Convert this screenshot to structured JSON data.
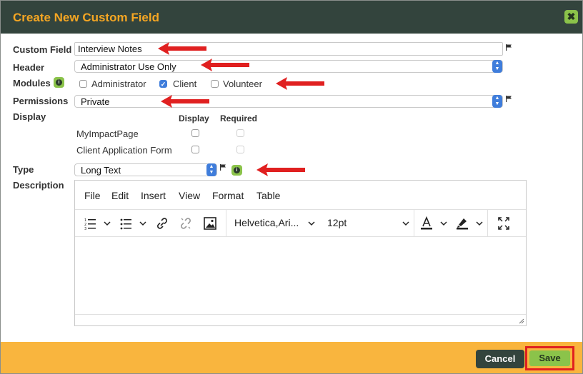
{
  "dialog": {
    "title": "Create New Custom Field",
    "close_icon": "close-icon"
  },
  "form": {
    "custom_field": {
      "label": "Custom Field",
      "value": "Interview Notes"
    },
    "header": {
      "label": "Header",
      "value": "Administrator Use Only"
    },
    "modules": {
      "label": "Modules",
      "options": [
        {
          "label": "Administrator",
          "checked": false
        },
        {
          "label": "Client",
          "checked": true
        },
        {
          "label": "Volunteer",
          "checked": false
        }
      ]
    },
    "permissions": {
      "label": "Permissions",
      "value": "Private"
    },
    "display": {
      "label": "Display",
      "col_display": "Display",
      "col_required": "Required",
      "rows": [
        {
          "label": "MyImpactPage",
          "display": false,
          "required": false
        },
        {
          "label": "Client Application Form",
          "display": false,
          "required": false
        }
      ]
    },
    "type": {
      "label": "Type",
      "value": "Long Text"
    },
    "description": {
      "label": "Description"
    }
  },
  "editor": {
    "menu": [
      "File",
      "Edit",
      "Insert",
      "View",
      "Format",
      "Table"
    ],
    "font_family": "Helvetica,Ari...",
    "font_size": "12pt"
  },
  "footer": {
    "cancel_label": "Cancel",
    "save_label": "Save"
  },
  "colors": {
    "title_bar": "#33443d",
    "title_text": "#f5a623",
    "accent_green": "#8bc34a",
    "footer": "#f9b53e",
    "annotation_red": "#e02020",
    "select_blue": "#3f7ddb"
  }
}
